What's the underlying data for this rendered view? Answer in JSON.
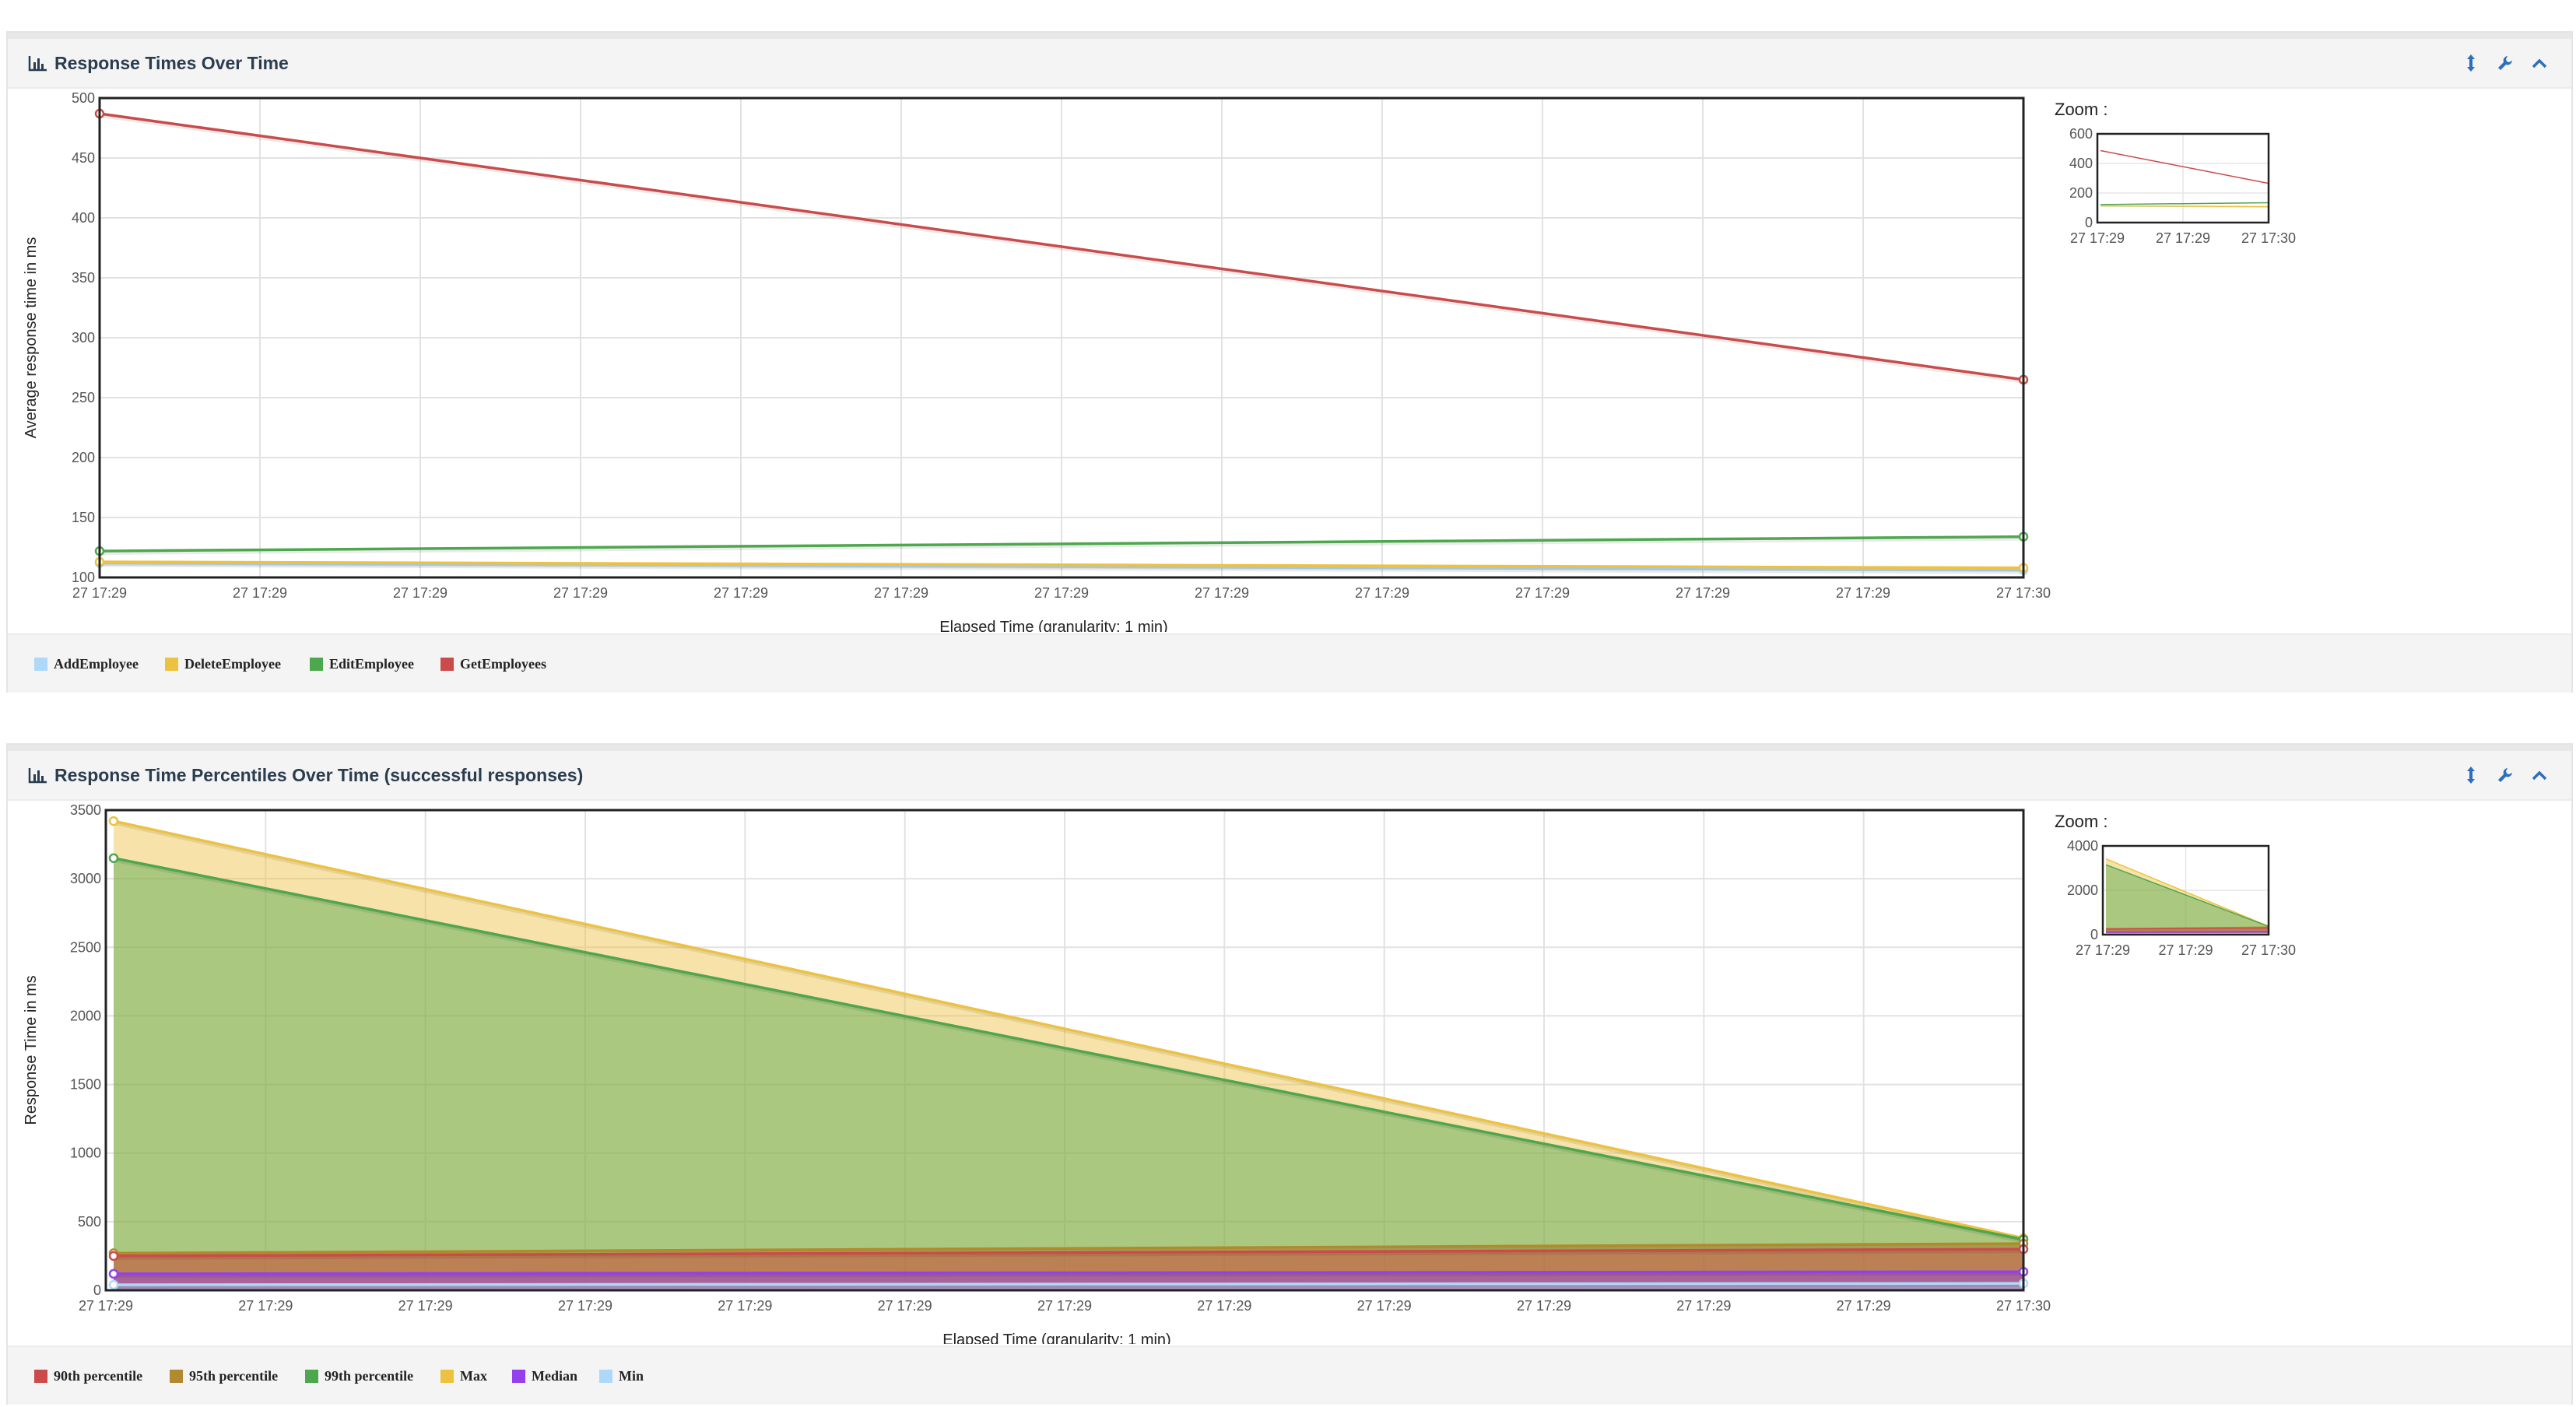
{
  "colors": {
    "AddEmployee": "#afd8f8",
    "DeleteEmployee": "#edc240",
    "EditEmployee": "#4da74d",
    "GetEmployees": "#cb4b4b",
    "p90": "#cb4b4b",
    "p95": "#b08a2e",
    "p99": "#4da74d",
    "max": "#edc240",
    "median": "#9440ed",
    "min": "#afd8f8"
  },
  "panels": [
    {
      "title": "Response Times Over Time",
      "zoom_label": "Zoom :",
      "icons": [
        "bar-chart-icon",
        "resize-vertical-icon",
        "wrench-icon",
        "chevron-up-icon"
      ]
    },
    {
      "title": "Response Time Percentiles Over Time (successful responses)",
      "zoom_label": "Zoom :",
      "icons": [
        "bar-chart-icon",
        "resize-vertical-icon",
        "wrench-icon",
        "chevron-up-icon"
      ]
    }
  ],
  "chart_data": [
    {
      "type": "line",
      "title": "Response Times Over Time",
      "xlabel": "Elapsed Time (granularity: 1 min)",
      "ylabel": "Average response time in ms",
      "ylim": [
        100,
        500
      ],
      "yticks": [
        "100",
        "150",
        "200",
        "250",
        "300",
        "350",
        "400",
        "450",
        "500"
      ],
      "xticks": [
        "27 17:29",
        "27 17:29",
        "27 17:29",
        "27 17:29",
        "27 17:29",
        "27 17:29",
        "27 17:29",
        "27 17:29",
        "27 17:29",
        "27 17:29",
        "27 17:29",
        "27 17:29",
        "27 17:30"
      ],
      "grid": true,
      "legend_position": "bottom",
      "x": [
        "27 17:29",
        "27 17:30"
      ],
      "series": [
        {
          "name": "AddEmployee",
          "values": [
            112,
            106
          ]
        },
        {
          "name": "DeleteEmployee",
          "values": [
            113,
            108
          ]
        },
        {
          "name": "EditEmployee",
          "values": [
            122,
            134
          ]
        },
        {
          "name": "GetEmployees",
          "values": [
            487,
            265
          ]
        }
      ],
      "zoom": {
        "yticks": [
          "0",
          "200",
          "400",
          "600"
        ],
        "xticks": [
          "27 17:29",
          "27 17:29",
          "27 17:30"
        ],
        "ylim": [
          0,
          600
        ]
      }
    },
    {
      "type": "area",
      "title": "Response Time Percentiles Over Time (successful responses)",
      "xlabel": "Elapsed Time (granularity: 1 min)",
      "ylabel": "Response Time in ms",
      "ylim": [
        0,
        3500
      ],
      "yticks": [
        "0",
        "500",
        "1000",
        "1500",
        "2000",
        "2500",
        "3000",
        "3500"
      ],
      "xticks": [
        "27 17:29",
        "27 17:29",
        "27 17:29",
        "27 17:29",
        "27 17:29",
        "27 17:29",
        "27 17:29",
        "27 17:29",
        "27 17:29",
        "27 17:29",
        "27 17:29",
        "27 17:29",
        "27 17:30"
      ],
      "grid": true,
      "legend_position": "bottom",
      "x": [
        "27 17:29",
        "27 17:30"
      ],
      "series": [
        {
          "name": "90th percentile",
          "values": [
            250,
            300
          ]
        },
        {
          "name": "95th percentile",
          "values": [
            270,
            340
          ]
        },
        {
          "name": "99th percentile",
          "values": [
            3150,
            370
          ]
        },
        {
          "name": "Max",
          "values": [
            3420,
            380
          ]
        },
        {
          "name": "Median",
          "values": [
            120,
            135
          ]
        },
        {
          "name": "Min",
          "values": [
            40,
            50
          ]
        }
      ],
      "zoom": {
        "yticks": [
          "0",
          "2000",
          "4000"
        ],
        "xticks": [
          "27 17:29",
          "27 17:29",
          "27 17:30"
        ],
        "ylim": [
          0,
          4000
        ]
      }
    }
  ]
}
